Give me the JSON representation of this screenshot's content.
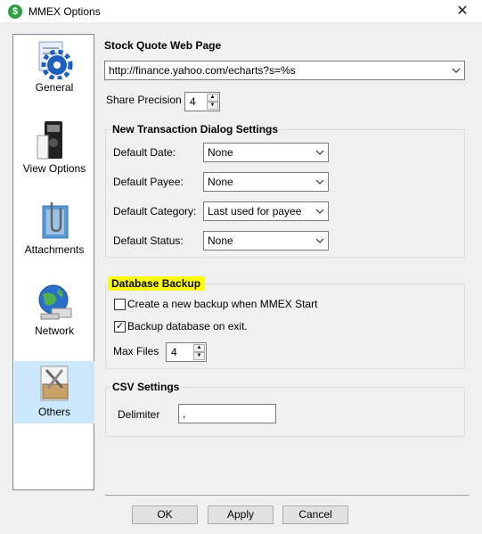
{
  "window": {
    "title": "MMEX Options",
    "app_icon_glyph": "$",
    "close_glyph": "✕"
  },
  "sidebar": {
    "items": [
      {
        "label": "General",
        "icon": "gear-icon",
        "selected": false
      },
      {
        "label": "View Options",
        "icon": "view-icon",
        "selected": false
      },
      {
        "label": "Attachments",
        "icon": "paperclip-icon",
        "selected": false
      },
      {
        "label": "Network",
        "icon": "globe-icon",
        "selected": false
      },
      {
        "label": "Others",
        "icon": "toolbox-icon",
        "selected": true
      }
    ]
  },
  "stock": {
    "heading": "Stock Quote Web Page",
    "url": "http://finance.yahoo.com/echarts?s=%s",
    "share_precision_label": "Share Precision",
    "share_precision_value": "4"
  },
  "transaction": {
    "heading": "New Transaction Dialog Settings",
    "fields": [
      {
        "label": "Default Date:",
        "value": "None"
      },
      {
        "label": "Default Payee:",
        "value": "None"
      },
      {
        "label": "Default Category:",
        "value": "Last used for payee"
      },
      {
        "label": "Default Status:",
        "value": "None"
      }
    ]
  },
  "backup": {
    "heading": "Database Backup",
    "highlight_color": "#ffff00",
    "create_label": "Create a new backup when MMEX Start",
    "create_checked": false,
    "exit_label": "Backup database on exit.",
    "exit_checked": true,
    "max_files_label": "Max Files",
    "max_files_value": "4"
  },
  "csv": {
    "heading": "CSV Settings",
    "delimiter_label": "Delimiter",
    "delimiter_value": ","
  },
  "buttons": {
    "ok": "OK",
    "apply": "Apply",
    "cancel": "Cancel"
  },
  "glyphs": {
    "check": "✓",
    "spin_up": "▲",
    "spin_down": "▼"
  }
}
